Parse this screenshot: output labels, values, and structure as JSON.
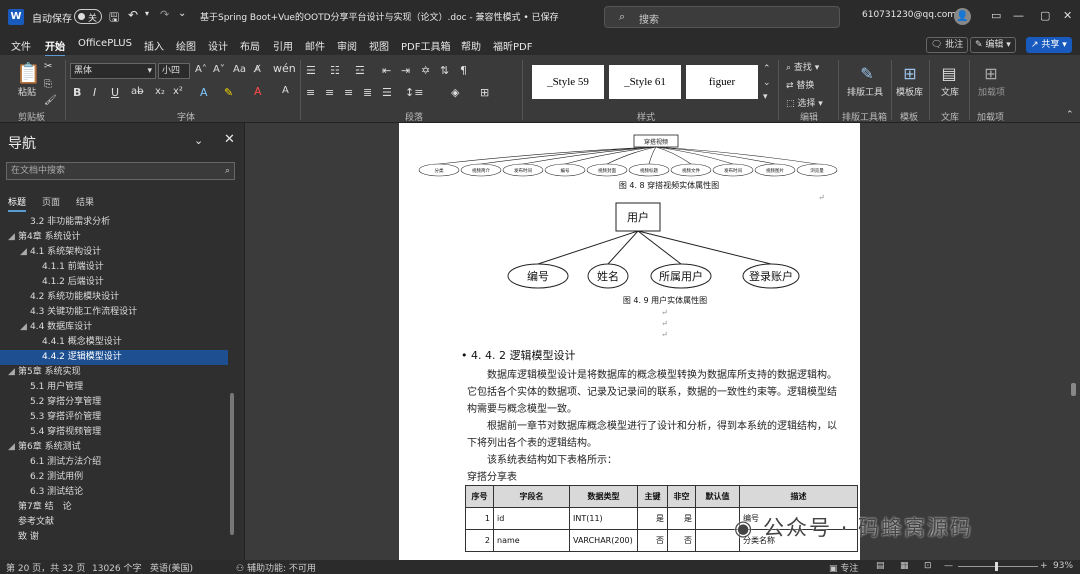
{
  "titlebar": {
    "autosave_label": "自动保存",
    "autosave_state": "关",
    "doc_title": "基于Spring Boot+Vue的OOTD分享平台设计与实现（论文）.doc - 兼容性模式 • 已保存",
    "search_placeholder": "搜索",
    "account": "610731230@qq.com"
  },
  "menu": {
    "items": [
      "文件",
      "开始",
      "OfficePLUS",
      "插入",
      "绘图",
      "设计",
      "布局",
      "引用",
      "邮件",
      "审阅",
      "视图",
      "PDF工具箱",
      "帮助",
      "福昕PDF"
    ],
    "comment_btn": "批注",
    "edit_btn": "编辑",
    "share_btn": "共享"
  },
  "ribbon": {
    "paste": "粘贴",
    "font_name": "黑体",
    "font_size": "小四",
    "styles": [
      "_Style 59",
      "_Style 61",
      "figuer"
    ],
    "find": "查找",
    "replace": "替换",
    "select": "选择",
    "layout_tool": "排版工具",
    "template_lib": "模板库",
    "library": "文库",
    "addins": "加载项",
    "groups": [
      "剪贴板",
      "字体",
      "段落",
      "样式",
      "编辑",
      "排版工具箱",
      "模板",
      "文库",
      "加载项"
    ]
  },
  "nav": {
    "title": "导航",
    "search_placeholder": "在文档中搜索",
    "tabs": [
      "标题",
      "页面",
      "结果"
    ],
    "items": [
      {
        "label": "3.2 非功能需求分析",
        "level": 2,
        "tri": ""
      },
      {
        "label": "第4章 系统设计",
        "level": 1,
        "tri": "◢"
      },
      {
        "label": "4.1 系统架构设计",
        "level": 2,
        "tri": "◢"
      },
      {
        "label": "4.1.1 前端设计",
        "level": 3,
        "tri": ""
      },
      {
        "label": "4.1.2 后端设计",
        "level": 3,
        "tri": ""
      },
      {
        "label": "4.2 系统功能模块设计",
        "level": 2,
        "tri": ""
      },
      {
        "label": "4.3 关键功能工作流程设计",
        "level": 2,
        "tri": ""
      },
      {
        "label": "4.4 数据库设计",
        "level": 2,
        "tri": "◢"
      },
      {
        "label": "4.4.1 概念模型设计",
        "level": 3,
        "tri": ""
      },
      {
        "label": "4.4.2 逻辑模型设计",
        "level": 3,
        "tri": "",
        "selected": true
      },
      {
        "label": "第5章 系统实现",
        "level": 1,
        "tri": "◢"
      },
      {
        "label": "5.1 用户管理",
        "level": 2,
        "tri": ""
      },
      {
        "label": "5.2 穿搭分享管理",
        "level": 2,
        "tri": ""
      },
      {
        "label": "5.3 穿搭评价管理",
        "level": 2,
        "tri": ""
      },
      {
        "label": "5.4 穿搭视频管理",
        "level": 2,
        "tri": ""
      },
      {
        "label": "第6章 系统测试",
        "level": 1,
        "tri": "◢"
      },
      {
        "label": "6.1 测试方法介绍",
        "level": 2,
        "tri": ""
      },
      {
        "label": "6.2 测试用例",
        "level": 2,
        "tri": ""
      },
      {
        "label": "6.3 测试结论",
        "level": 2,
        "tri": ""
      },
      {
        "label": "第7章 结　论",
        "level": 1,
        "tri": ""
      },
      {
        "label": "参考文献",
        "level": 1,
        "tri": ""
      },
      {
        "label": "致 谢",
        "level": 1,
        "tri": ""
      }
    ]
  },
  "doc": {
    "fig48_root": "穿搭视频",
    "fig48_attrs": [
      "分类",
      "视频简介",
      "发布时间",
      "编号",
      "视频封面",
      "视频标题",
      "视频文件",
      "发布时间",
      "视频图片",
      "浏览量"
    ],
    "fig48_caption": "图 4. 8  穿搭视频实体属性图",
    "fig49_root": "用户",
    "fig49_attrs": [
      "编号",
      "姓名",
      "所属用户",
      "登录账户"
    ],
    "fig49_caption": "图 4. 9  用户实体属性图",
    "heading": "4. 4. 2   逻辑模型设计",
    "para1_l1": "数据库逻辑模型设计是将数据库的概念模型转换为数据库所支持的数据逻辑构。",
    "para1_l2": "它包括各个实体的数据项、记录及记录间的联系，数据的一致性约束等。逻辑模型结",
    "para1_l3": "构需要与概念模型一致。",
    "para2_l1": "根据前一章节对数据库概念模型进行了设计和分析，得到本系统的逻辑结构，以",
    "para2_l2": "下将列出各个表的逻辑结构。",
    "para3": "该系统表结构如下表格所示：",
    "table_title": "穿搭分享表",
    "table": {
      "headers": [
        "序号",
        "字段名",
        "数据类型",
        "主键",
        "非空",
        "默认值",
        "描述"
      ],
      "rows": [
        [
          "1",
          "id",
          "INT(11)",
          "是",
          "是",
          "",
          "编号"
        ],
        [
          "2",
          "name",
          "VARCHAR(200)",
          "否",
          "否",
          "",
          "分类名称"
        ]
      ]
    }
  },
  "status": {
    "page": "第 20 页，共 32 页",
    "words": "13026 个字",
    "lang": "英语(美国)",
    "accessibility": "辅助功能: 不可用",
    "focus": "专注",
    "zoom": "93%"
  },
  "watermark": "公众号 · 码蜂窝源码"
}
